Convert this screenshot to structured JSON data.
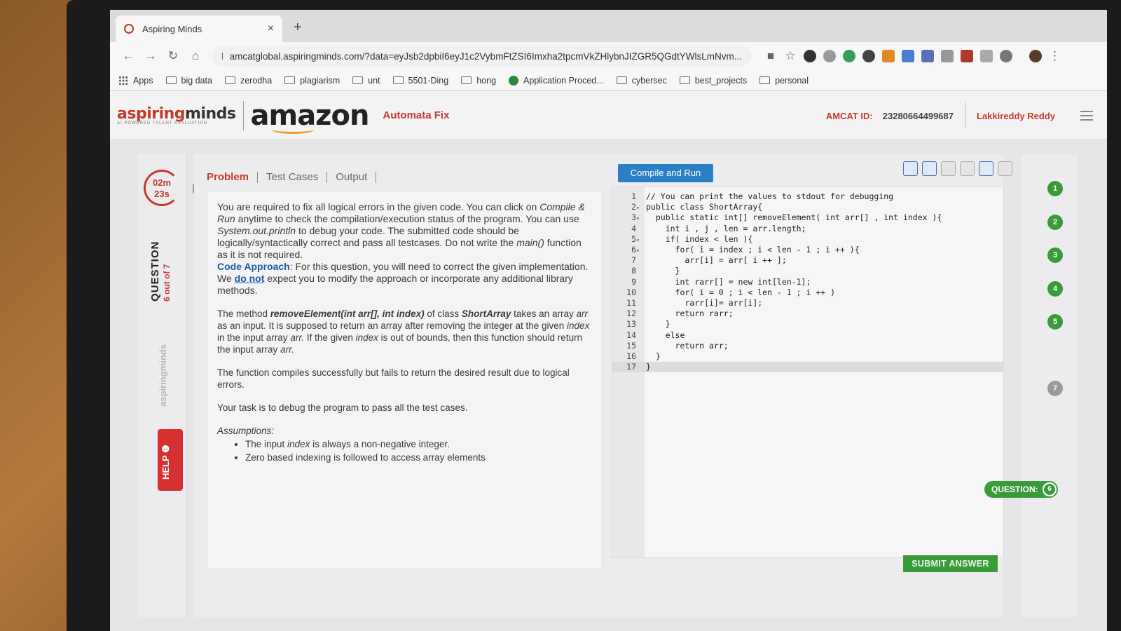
{
  "browser": {
    "tab_title": "Aspiring Minds",
    "tab_close": "×",
    "new_tab": "+",
    "url": "amcatglobal.aspiringminds.com/?data=eyJsb2dpbiI6eyJ1c2VybmFtZSI6Imxha2tpcmVkZHlybnJIZGR5QGdtYWlsLmNvm...",
    "bookmarks": [
      "Apps",
      "big data",
      "zerodha",
      "plagiarism",
      "unt",
      "5501-Ding",
      "hong",
      "Application Proced...",
      "cybersec",
      "best_projects",
      "personal"
    ]
  },
  "header": {
    "logo_part1": "aspiring",
    "logo_part2": "minds",
    "logo_tagline": "AI POWERED TALENT EVALUATION",
    "brand": "amazon",
    "product": "Automata Fix",
    "amcat_label": "AMCAT ID:",
    "amcat_id": "23280664499687",
    "user_name": "Lakkireddy Reddy"
  },
  "sidebar": {
    "timer_min": "02m",
    "timer_sec": "23s",
    "question_label": "QUESTION",
    "question_progress": "6 out of 7",
    "watermark": "aspiringminds",
    "help_label": "HELP ❶"
  },
  "tabs": [
    "Problem",
    "Test Cases",
    "Output"
  ],
  "compile_label": "Compile and Run",
  "problem": {
    "intro_a": "You are required to fix all logical errors in the given code. You can click on ",
    "intro_b": "Compile & Run",
    "intro_c": " anytime to check the compilation/execution status of the program. You can use ",
    "intro_d": "System.out.println",
    "intro_e": " to debug your code. The submitted code should be logically/syntactically correct and pass all testcases. Do not write the ",
    "intro_f": "main()",
    "intro_g": " function as it is not required.",
    "approach_head": "Code Approach",
    "approach_a": ": For this question, you will need to correct the given implementation. We ",
    "approach_donot": "do not",
    "approach_b": " expect you to modify the approach or incorporate any additional library methods.",
    "method_a": "The method ",
    "method_sig": "removeElement(int arr[], int index)",
    "method_b": " of class ",
    "method_class": "ShortArray",
    "method_c": " takes an array ",
    "method_arr": "arr",
    "method_d": " as an input. It is supposed to return an array after removing the integer at the given ",
    "method_index": "index",
    "method_e": " in the input array ",
    "method_arr2": "arr.",
    "method_f": " If the given ",
    "method_index2": "index",
    "method_g": " is out of bounds, then this function should return the input array ",
    "method_arr3": "arr.",
    "compiles": "The function compiles successfully but fails to return the desired result due to logical errors.",
    "task": "Your task is to debug the program to pass all the test cases.",
    "assumptions_head": "Assumptions:",
    "assume1_a": "The input ",
    "assume1_b": "index",
    "assume1_c": " is always a non-negative integer.",
    "assume2": "Zero based indexing is followed to access array elements"
  },
  "code": [
    {
      "n": "1",
      "fold": "",
      "text": "// You can print the values to stdout for debugging"
    },
    {
      "n": "2",
      "fold": "▾",
      "text": "public class ShortArray{"
    },
    {
      "n": "3",
      "fold": "▾",
      "text": "  public static int[] removeElement( int arr[] , int index ){"
    },
    {
      "n": "4",
      "fold": "",
      "text": "    int i , j , len = arr.length;"
    },
    {
      "n": "5",
      "fold": "▾",
      "text": "    if( index < len ){"
    },
    {
      "n": "6",
      "fold": "▾",
      "text": "      for( i = index ; i < len - 1 ; i ++ ){"
    },
    {
      "n": "7",
      "fold": "",
      "text": "        arr[i] = arr[ i ++ ];"
    },
    {
      "n": "8",
      "fold": "",
      "text": "      }"
    },
    {
      "n": "9",
      "fold": "",
      "text": "      int rarr[] = new int[len-1];"
    },
    {
      "n": "10",
      "fold": "",
      "text": "      for( i = 0 ; i < len - 1 ; i ++ )"
    },
    {
      "n": "11",
      "fold": "",
      "text": "        rarr[i]= arr[i];"
    },
    {
      "n": "12",
      "fold": "",
      "text": "      return rarr;"
    },
    {
      "n": "13",
      "fold": "",
      "text": "    }"
    },
    {
      "n": "14",
      "fold": "",
      "text": "    else"
    },
    {
      "n": "15",
      "fold": "",
      "text": "      return arr;"
    },
    {
      "n": "16",
      "fold": "",
      "text": "  }"
    },
    {
      "n": "17",
      "fold": "",
      "text": "}"
    }
  ],
  "tracker": {
    "questions": [
      "1",
      "2",
      "3",
      "4",
      "5",
      "6",
      "7"
    ],
    "current_label": "QUESTION:",
    "current": "6"
  },
  "submit_label": "SUBMIT ANSWER",
  "colors": {
    "accent_red": "#c53a2c",
    "compile_blue": "#2a7fc6",
    "success_green": "#3a9b3a"
  }
}
